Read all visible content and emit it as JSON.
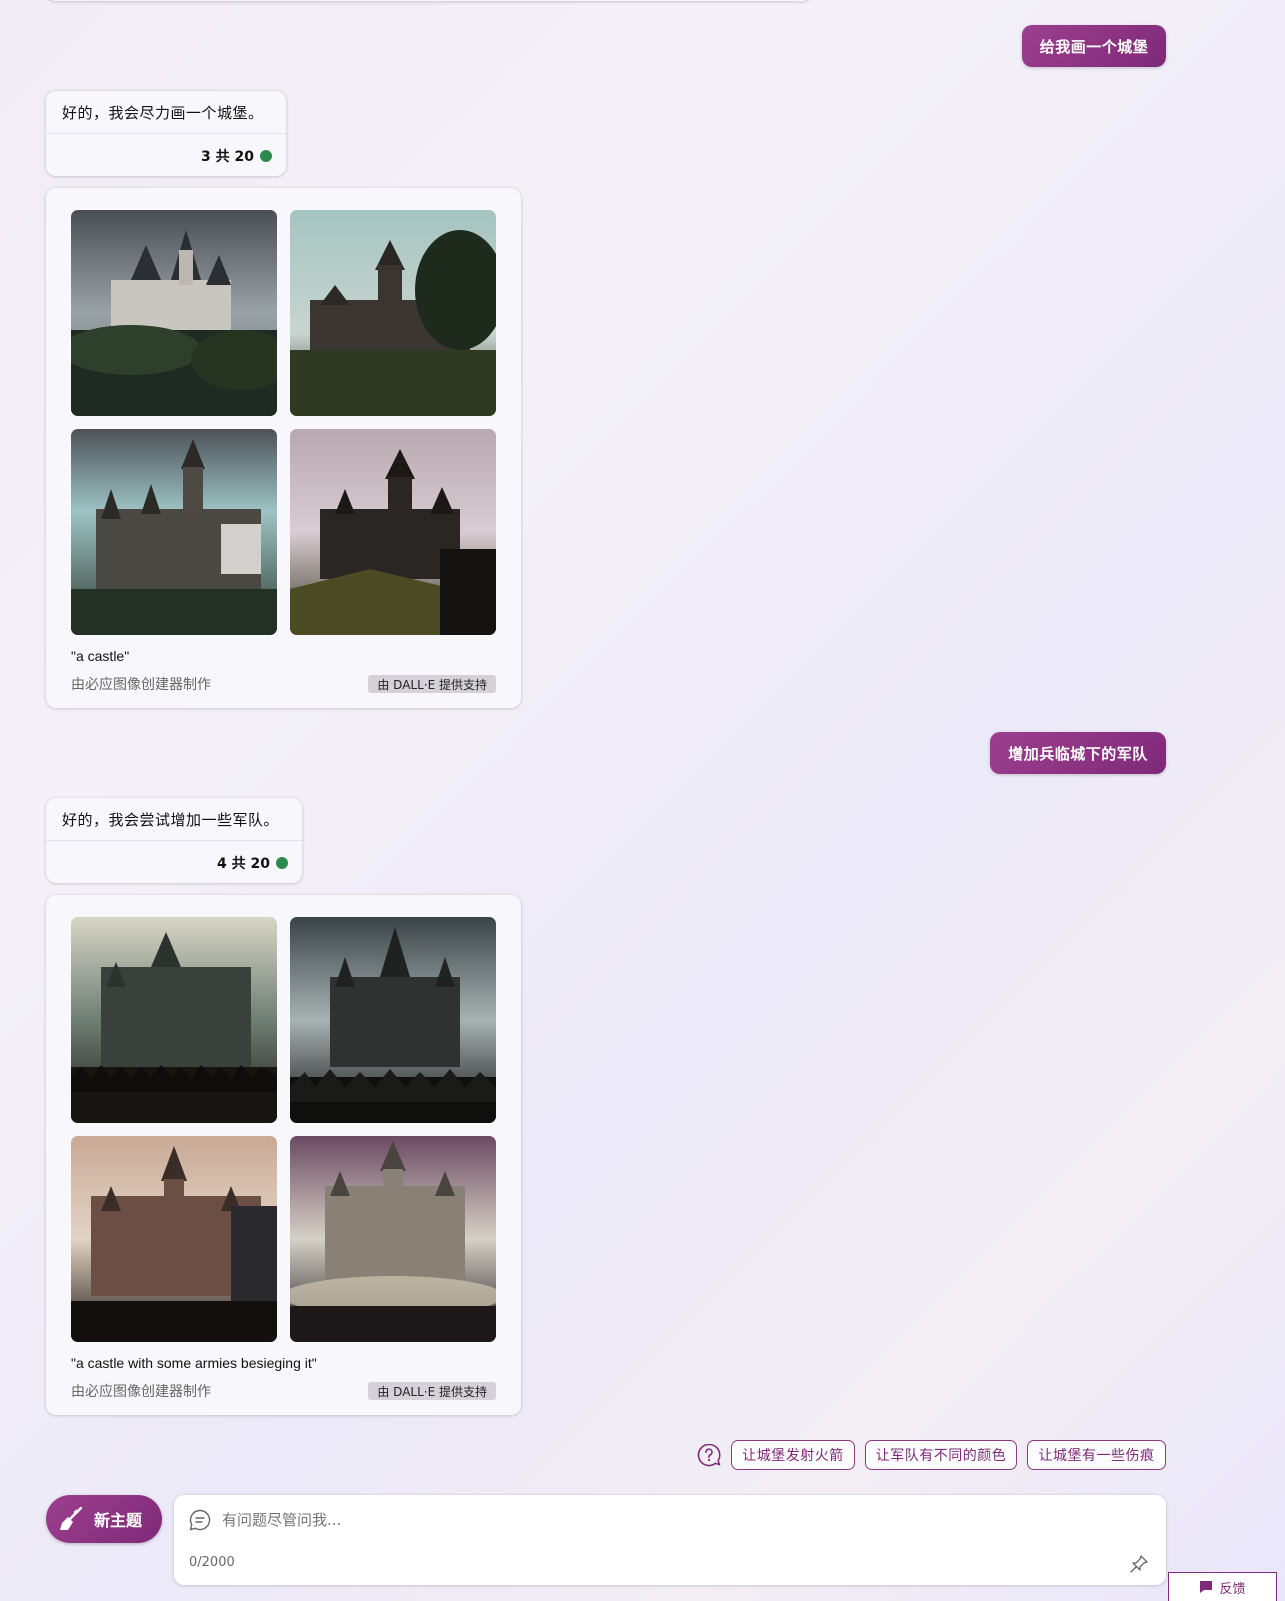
{
  "conversation": {
    "user_msg_1": "给我画一个城堡",
    "bot_msg_1": {
      "text": "好的，我会尽力画一个城堡。",
      "counter": "3 共 20"
    },
    "image_set_1": {
      "caption": "\"a castle\"",
      "made_by": "由必应图像创建器制作",
      "powered_by": "由 DALL·E 提供支持"
    },
    "user_msg_2": "增加兵临城下的军队",
    "bot_msg_2": {
      "text": "好的，我会尝试增加一些军队。",
      "counter": "4 共 20"
    },
    "image_set_2": {
      "caption": "\"a castle with some armies besieging it\"",
      "made_by": "由必应图像创建器制作",
      "powered_by": "由 DALL·E 提供支持"
    }
  },
  "suggestions": {
    "icon": "question-circle-icon",
    "items": [
      "让城堡发射火箭",
      "让军队有不同的颜色",
      "让城堡有一些伤痕"
    ]
  },
  "composer": {
    "new_topic_label": "新主题",
    "placeholder": "有问题尽管问我...",
    "char_count": "0/2000"
  },
  "feedback_label": "反馈",
  "colors": {
    "accent": "#7e2a78",
    "status_green": "#2d8a4e"
  }
}
